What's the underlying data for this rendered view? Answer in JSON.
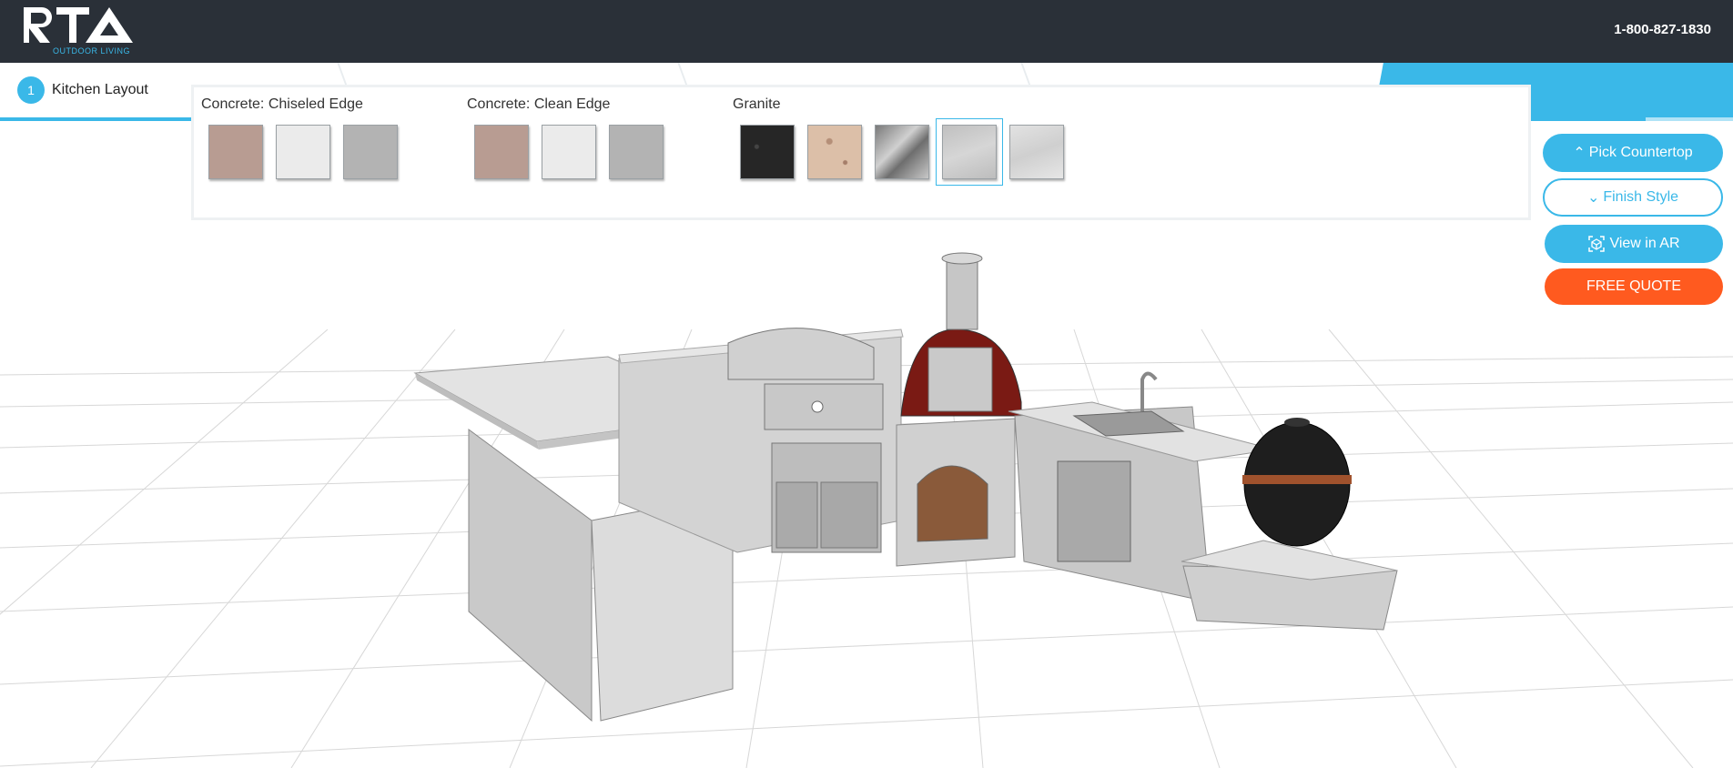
{
  "header": {
    "logo_text": "RTA",
    "logo_sub": "OUTDOOR LIVING",
    "phone": "1-800-827-1830"
  },
  "steps": [
    {
      "num": "1",
      "label": "Kitchen Layout",
      "active": true
    }
  ],
  "countertop_panel": {
    "groups": [
      {
        "title": "Concrete: Chiseled Edge",
        "swatches": [
          "#b89c92",
          "#ebebeb",
          "#b3b3b3"
        ]
      },
      {
        "title": "Concrete: Clean Edge",
        "swatches": [
          "#b89c92",
          "#ebebeb",
          "#b3b3b3"
        ]
      },
      {
        "title": "Granite",
        "swatches": [
          "#2b2b2b",
          "#d8b8a0",
          "#9a9a9a",
          "#c8c8c8",
          "#dcdcdc"
        ],
        "selected_index": 3
      }
    ]
  },
  "buttons": {
    "pick_countertop": "Pick Countertop",
    "finish_style": "Finish Style",
    "view_in_ar": "View in AR",
    "free_quote": "FREE QUOTE"
  },
  "colors": {
    "accent": "#3ab8e8",
    "header_bg": "#2a3038",
    "quote": "#ff5a1f"
  }
}
